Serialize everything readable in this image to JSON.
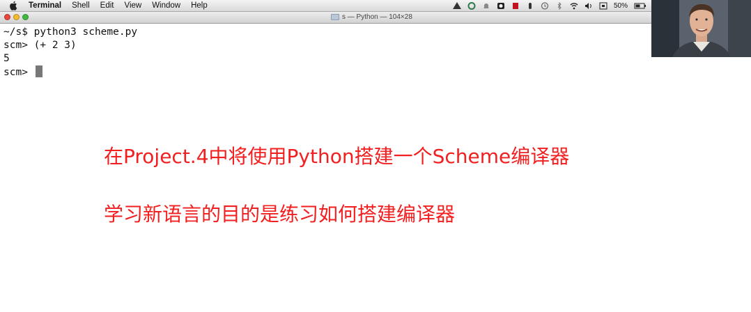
{
  "menubar": {
    "items": [
      "Terminal",
      "Shell",
      "Edit",
      "View",
      "Window",
      "Help"
    ],
    "battery": "50%"
  },
  "window": {
    "title": "s — Python — 104×28"
  },
  "terminal": {
    "lines": [
      "~/s$ python3 scheme.py",
      "scm> (+ 2 3)",
      "5",
      "scm> "
    ]
  },
  "subtitles": [
    "在Project.4中将使用Python搭建一个Scheme编译器",
    "学习新语言的目的是练习如何搭建编译器"
  ],
  "colors": {
    "subtitle": "#f11f1f",
    "close": "#e9463d",
    "minimize": "#f4bb2b",
    "zoom": "#42b843"
  }
}
